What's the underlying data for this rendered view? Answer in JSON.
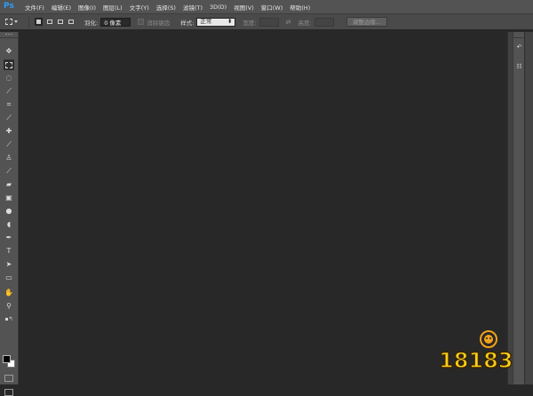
{
  "app": {
    "logo": "Ps"
  },
  "menu": [
    "文件(F)",
    "编辑(E)",
    "图像(I)",
    "图层(L)",
    "文字(Y)",
    "选择(S)",
    "滤镜(T)",
    "3D(D)",
    "视图(V)",
    "窗口(W)",
    "帮助(H)"
  ],
  "options": {
    "feather_label": "羽化:",
    "feather_value": "0 像素",
    "antialias_label": "消除锯齿",
    "style_label": "样式:",
    "style_value": "正常",
    "width_label": "宽度:",
    "height_label": "高度:",
    "refine_edge_label": "调整边缘..."
  },
  "toolbar": {
    "tools": [
      "move-icon",
      "rectangular-marquee-icon",
      "lasso-icon",
      "quick-selection-icon",
      "crop-icon",
      "eyedropper-icon",
      "spot-healing-icon",
      "brush-icon",
      "clone-stamp-icon",
      "history-brush-icon",
      "eraser-icon",
      "gradient-icon",
      "blur-icon",
      "dodge-icon",
      "pen-icon",
      "type-icon",
      "path-selection-icon",
      "rectangle-shape-icon",
      "hand-icon",
      "zoom-icon"
    ],
    "foreground_color": "#000000",
    "background_color": "#ffffff"
  },
  "watermark": {
    "text": "18183"
  },
  "colors": {
    "accent": "#2e9cf7",
    "canvas": "#282828",
    "panel": "#535353"
  }
}
